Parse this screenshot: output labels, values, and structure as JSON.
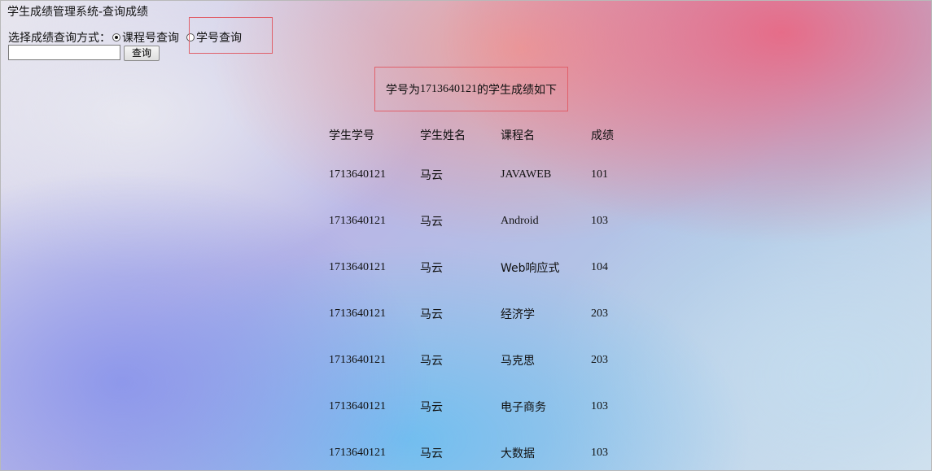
{
  "page": {
    "title": "学生成绩管理系统-查询成绩"
  },
  "query": {
    "mode_label": "选择成绩查询方式：",
    "options": [
      {
        "label": "课程号查询",
        "selected": true
      },
      {
        "label": "学号查询",
        "selected": false
      }
    ],
    "input_value": "",
    "button_label": "查询"
  },
  "result": {
    "prefix": "学号为",
    "student_id": "1713640121",
    "suffix": "的学生成绩如下"
  },
  "table": {
    "headers": [
      "学生学号",
      "学生姓名",
      "课程名",
      "成绩"
    ],
    "rows": [
      [
        "1713640121",
        "马云",
        "JAVAWEB",
        "101"
      ],
      [
        "1713640121",
        "马云",
        "Android",
        "103"
      ],
      [
        "1713640121",
        "马云",
        "Web响应式",
        "104"
      ],
      [
        "1713640121",
        "马云",
        "经济学",
        "203"
      ],
      [
        "1713640121",
        "马云",
        "马克思",
        "203"
      ],
      [
        "1713640121",
        "马云",
        "电子商务",
        "103"
      ],
      [
        "1713640121",
        "马云",
        "大数据",
        "103"
      ]
    ]
  },
  "colors": {
    "highlight_border": "#e0606a"
  }
}
